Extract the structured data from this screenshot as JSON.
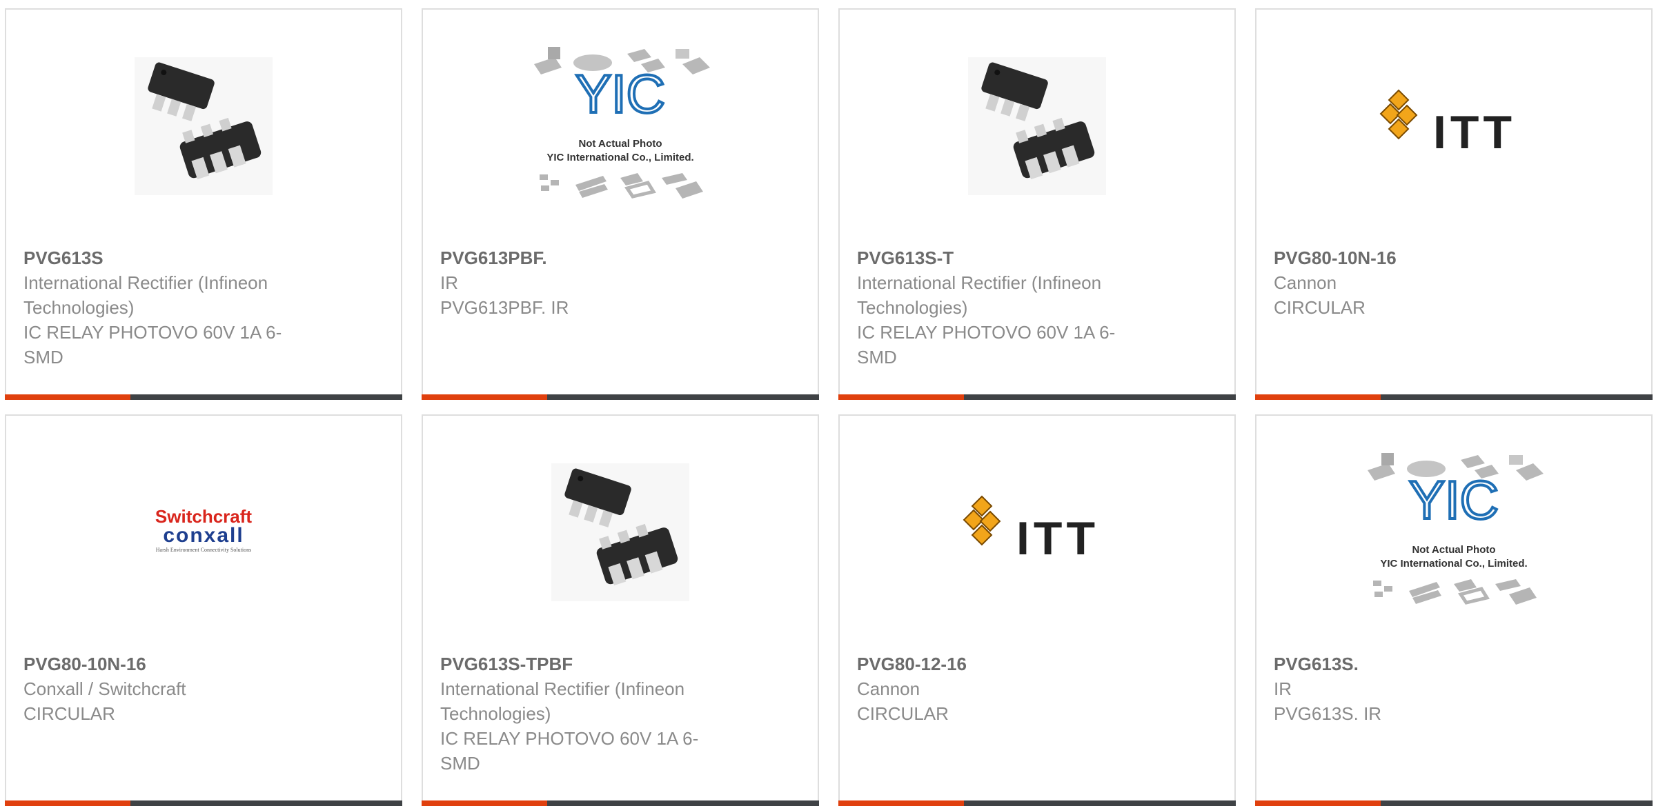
{
  "products": [
    {
      "part": "PVG613S",
      "manufacturer": "International Rectifier (Infineon Technologies)",
      "description": "IC RELAY PHOTOVO 60V 1A 6-SMD",
      "image": "smd-relay-photo"
    },
    {
      "part": "PVG613PBF.",
      "manufacturer": "IR",
      "description": "PVG613PBF. IR",
      "image": "yic-placeholder",
      "placeholder_lines": [
        "Not Actual Photo",
        "YIC International Co., Limited."
      ]
    },
    {
      "part": "PVG613S-T",
      "manufacturer": "International Rectifier (Infineon Technologies)",
      "description": "IC RELAY PHOTOVO 60V 1A 6-SMD",
      "image": "smd-relay-photo"
    },
    {
      "part": "PVG80-10N-16",
      "manufacturer": "Cannon",
      "description": "CIRCULAR",
      "image": "itt-logo",
      "logo_text": "ITT"
    },
    {
      "part": "PVG80-10N-16",
      "manufacturer": "Conxall / Switchcraft",
      "description": "CIRCULAR",
      "image": "switchcraft-conxall-logo",
      "logo_top": "Switchcraft",
      "logo_mid": "conxall",
      "logo_sub": "Harsh Environment Connectivity Solutions"
    },
    {
      "part": "PVG613S-TPBF",
      "manufacturer": "International Rectifier (Infineon Technologies)",
      "description": "IC RELAY PHOTOVO 60V 1A 6-SMD",
      "image": "smd-relay-photo"
    },
    {
      "part": "PVG80-12-16",
      "manufacturer": "Cannon",
      "description": "CIRCULAR",
      "image": "itt-logo",
      "logo_text": "ITT"
    },
    {
      "part": "PVG613S.",
      "manufacturer": "IR",
      "description": "PVG613S. IR",
      "image": "yic-placeholder",
      "placeholder_lines": [
        "Not Actual Photo",
        "YIC International Co., Limited."
      ]
    }
  ],
  "colors": {
    "accent": "#e0400e",
    "bar": "#3f4245",
    "text": "#8a8a8a",
    "title": "#6b6b6b",
    "itt_orange": "#f2a51a",
    "switchcraft_red": "#d9251c",
    "conxall_blue": "#1e3f8f",
    "yic_blue": "#1f6fb5"
  }
}
